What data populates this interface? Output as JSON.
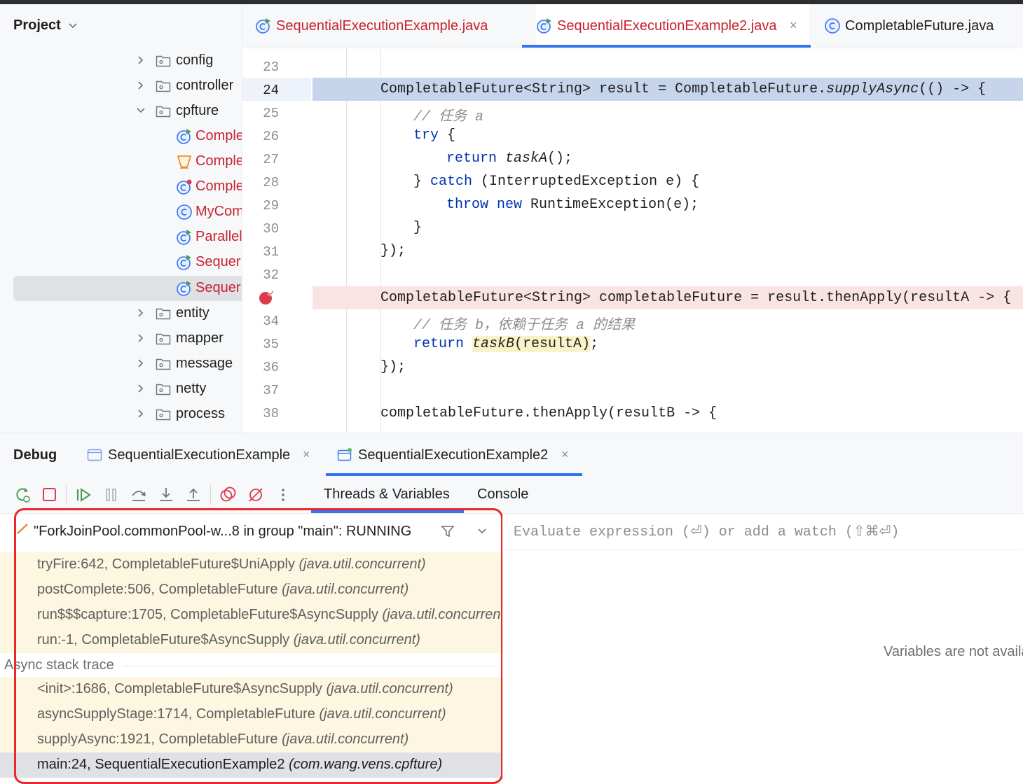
{
  "project": {
    "title": "Project",
    "tree": [
      {
        "type": "folder",
        "label": "config"
      },
      {
        "type": "folder",
        "label": "controller"
      },
      {
        "type": "folder-open",
        "label": "cpfture"
      },
      {
        "type": "class",
        "label": "Comple"
      },
      {
        "type": "class-abstract",
        "label": "Comple"
      },
      {
        "type": "class-run",
        "label": "Comple"
      },
      {
        "type": "class-plain",
        "label": "MyCom"
      },
      {
        "type": "class",
        "label": "Parallel"
      },
      {
        "type": "class",
        "label": "Sequer"
      },
      {
        "type": "class",
        "label": "Sequer"
      },
      {
        "type": "folder",
        "label": "entity"
      },
      {
        "type": "folder",
        "label": "mapper"
      },
      {
        "type": "folder",
        "label": "message"
      },
      {
        "type": "folder",
        "label": "netty"
      },
      {
        "type": "folder",
        "label": "process"
      }
    ]
  },
  "editor": {
    "tabs": [
      {
        "label": "SequentialExecutionExample.java"
      },
      {
        "label": "SequentialExecutionExample2.java",
        "close": "×"
      },
      {
        "label": "CompletableFuture.java"
      }
    ],
    "line_numbers": [
      "23",
      "24",
      "25",
      "26",
      "27",
      "28",
      "29",
      "30",
      "31",
      "32",
      "33",
      "34",
      "35",
      "36",
      "37",
      "38"
    ],
    "code": {
      "l24a": "CompletableFuture<String> result = CompletableFuture.",
      "l24b": "supplyAsync",
      "l24c": "(() -> {",
      "l25": "// 任务 a",
      "l26a": "try",
      "l26b": " {",
      "l27a": "return",
      "l27b": " ",
      "l27c": "taskA",
      "l27d": "();",
      "l28a": "} ",
      "l28b": "catch",
      "l28c": " (InterruptedException e) {",
      "l29a": "throw",
      "l29b": " ",
      "l29c": "new",
      "l29d": " RuntimeException(e);",
      "l30": "}",
      "l31": "});",
      "l33": "CompletableFuture<String> completableFuture = result.thenApply(resultA -> {",
      "l34": "// 任务 b，依赖于任务 a 的结果",
      "l35a": "return",
      "l35b": " ",
      "l35c": "taskB",
      "l35d": "(resultA)",
      "l35e": ";",
      "l36": "});",
      "l38": "completableFuture.thenApply(resultB -> {"
    }
  },
  "debug": {
    "title": "Debug",
    "tabs": [
      {
        "label": "SequentialExecutionExample",
        "close": "×"
      },
      {
        "label": "SequentialExecutionExample2",
        "close": "×"
      }
    ],
    "subtabs": [
      "Threads & Variables",
      "Console"
    ],
    "thread": "\"ForkJoinPool.commonPool-w...8 in group \"main\": RUNNING",
    "frames": [
      {
        "method": "tryFire:642, CompletableFuture$UniApply ",
        "pkg": "(java.util.concurrent)"
      },
      {
        "method": "postComplete:506, CompletableFuture ",
        "pkg": "(java.util.concurrent)"
      },
      {
        "method": "run$$$capture:1705, CompletableFuture$AsyncSupply ",
        "pkg": "(java.util.concurrent)"
      },
      {
        "method": "run:-1, CompletableFuture$AsyncSupply ",
        "pkg": "(java.util.concurrent)"
      }
    ],
    "async_label": "Async stack trace",
    "async_frames": [
      {
        "method": "<init>:1686, CompletableFuture$AsyncSupply ",
        "pkg": "(java.util.concurrent)"
      },
      {
        "method": "asyncSupplyStage:1714, CompletableFuture ",
        "pkg": "(java.util.concurrent)"
      },
      {
        "method": "supplyAsync:1921, CompletableFuture ",
        "pkg": "(java.util.concurrent)"
      },
      {
        "method": "main:24, SequentialExecutionExample2 ",
        "pkg": "(com.wang.vens.cpfture)"
      }
    ],
    "evaluate_placeholder": "Evaluate expression (⏎) or add a watch (⇧⌘⏎)",
    "variables_message": "Variables are not available"
  },
  "colors": {
    "accent": "#3574f0",
    "error_red": "#e8282b",
    "keyword": "#0033b3",
    "class_red": "#c7222d",
    "current_line": "#c6d4ec",
    "breakpoint_line": "#fae3e3"
  }
}
